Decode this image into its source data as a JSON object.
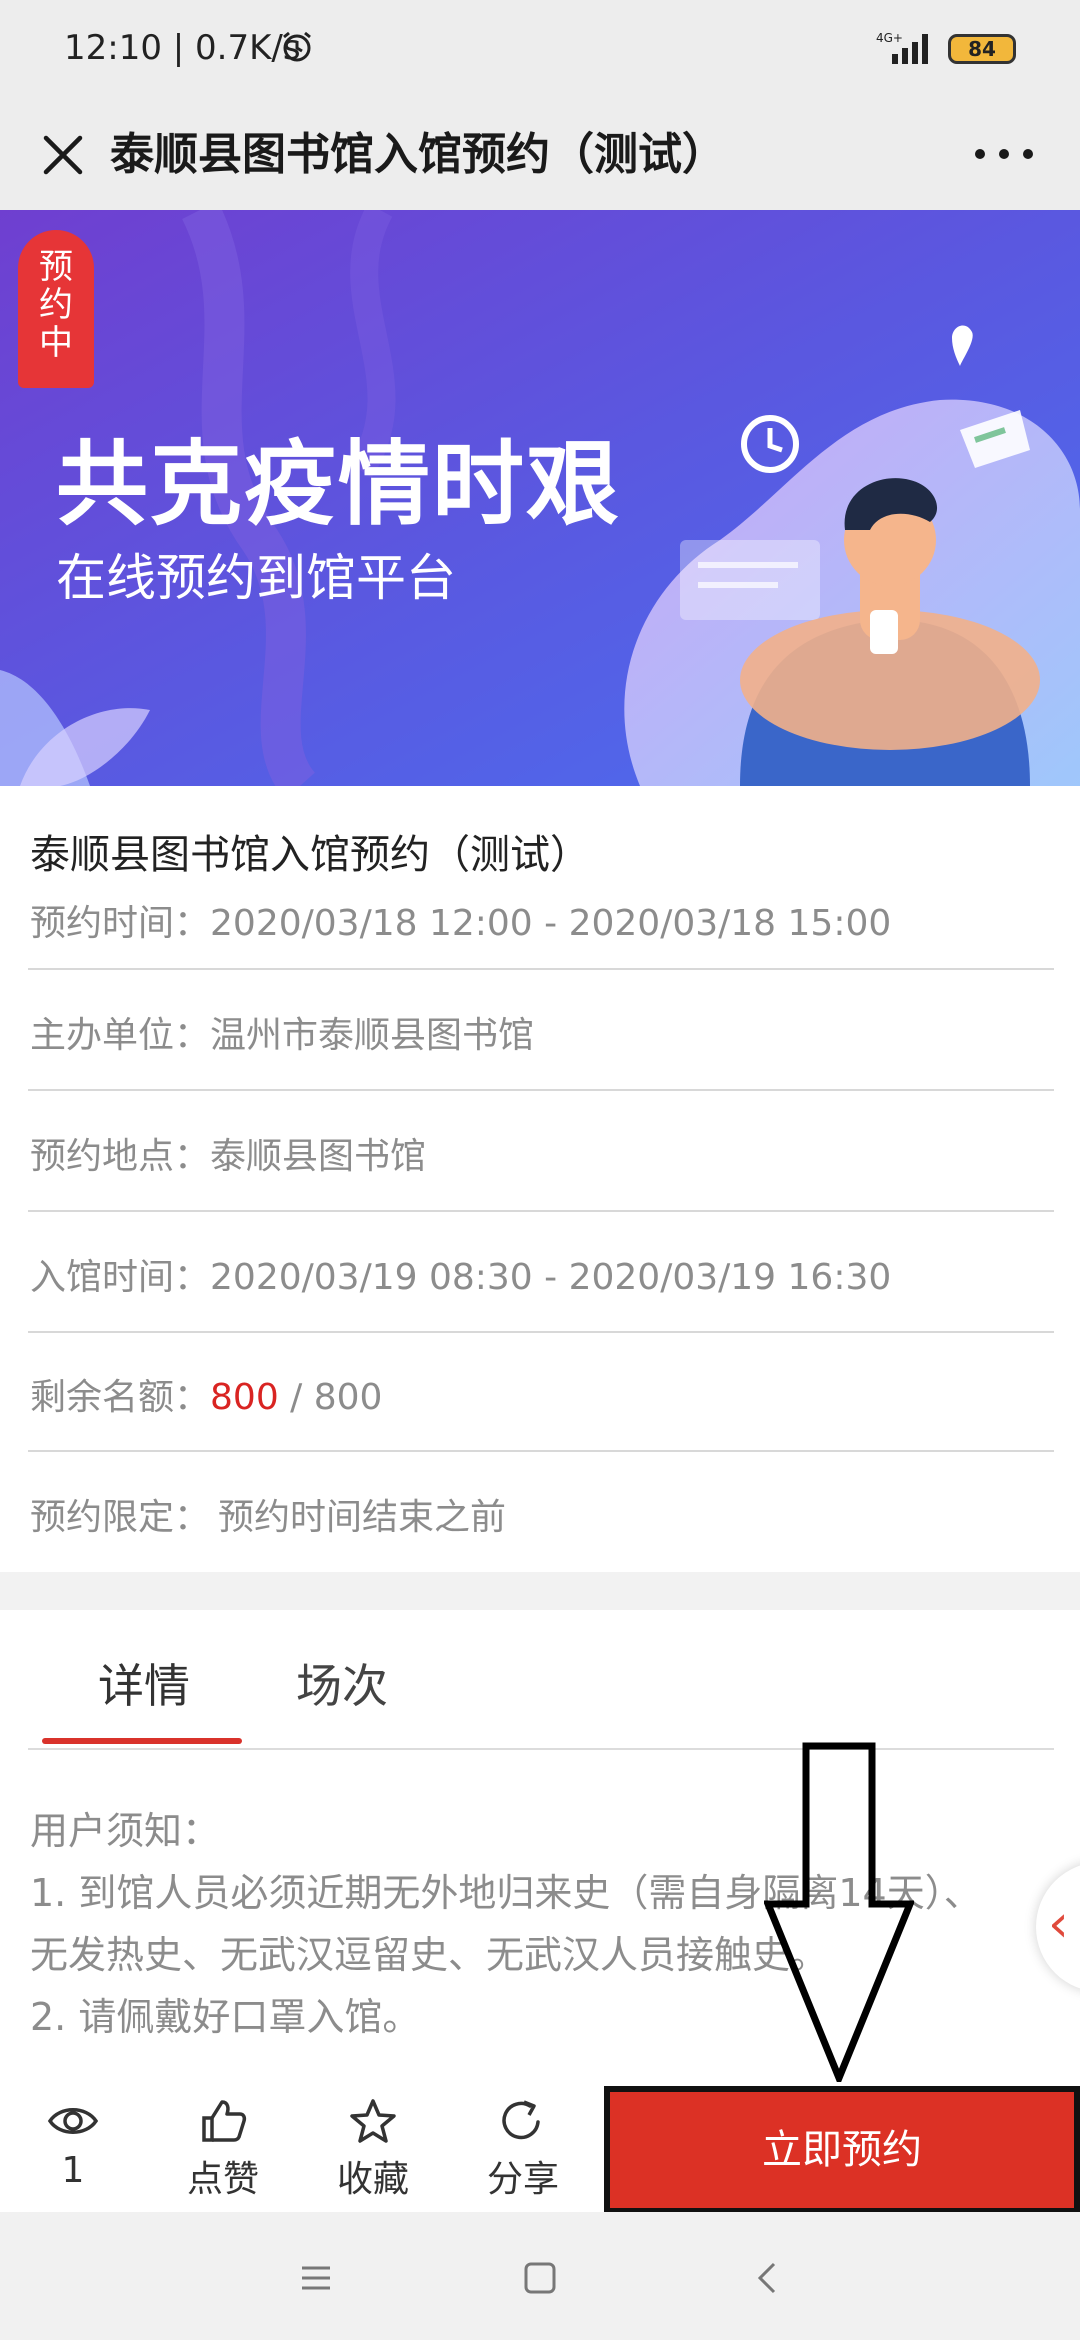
{
  "status_bar": {
    "time_speed": "12:10 | 0.7K/s",
    "network": "4G+",
    "battery": "84"
  },
  "title_bar": {
    "title": "泰顺县图书馆入馆预约（测试）"
  },
  "banner": {
    "status_tag": [
      "预",
      "约",
      "中"
    ],
    "headline": "共克疫情时艰",
    "subline": "在线预约到馆平台"
  },
  "event": {
    "title": "泰顺县图书馆入馆预约（测试）",
    "booking_time_label": "预约时间：",
    "booking_time_value": "2020/03/18 12:00 - 2020/03/18 15:00",
    "organizer_label": "主办单位：",
    "organizer_value": "温州市泰顺县图书馆",
    "location_label": "预约地点：",
    "location_value": "泰顺县图书馆",
    "entry_time_label": "入馆时间：",
    "entry_time_value": "2020/03/19 08:30 - 2020/03/19 16:30",
    "quota_label": "剩余名额：",
    "quota_remaining": "800",
    "quota_total": " / 800",
    "limit_label": "预约限定：",
    "limit_value": "预约时间结束之前"
  },
  "tabs": [
    {
      "label": "详情",
      "active": true
    },
    {
      "label": "场次",
      "active": false
    }
  ],
  "notice": {
    "heading": "用户须知：",
    "line1": "1. 到馆人员必须近期无外地归来史（需自身隔离14天）、",
    "line2": "无发热史、无武汉逗留史、无武汉人员接触史。",
    "line3": "2. 请佩戴好口罩入馆。"
  },
  "actions": {
    "views": "1",
    "like": "点赞",
    "favorite": "收藏",
    "share": "分享",
    "book": "立即预约"
  },
  "colors": {
    "accent_red": "#dc3125",
    "banner_purple": "#6a4fd8",
    "quota_red": "#d92422"
  },
  "icons": {
    "close": "close-icon",
    "more": "more-icon",
    "eye": "eye-icon",
    "like": "thumbs-up-icon",
    "favorite": "star-icon",
    "share": "share-icon"
  }
}
